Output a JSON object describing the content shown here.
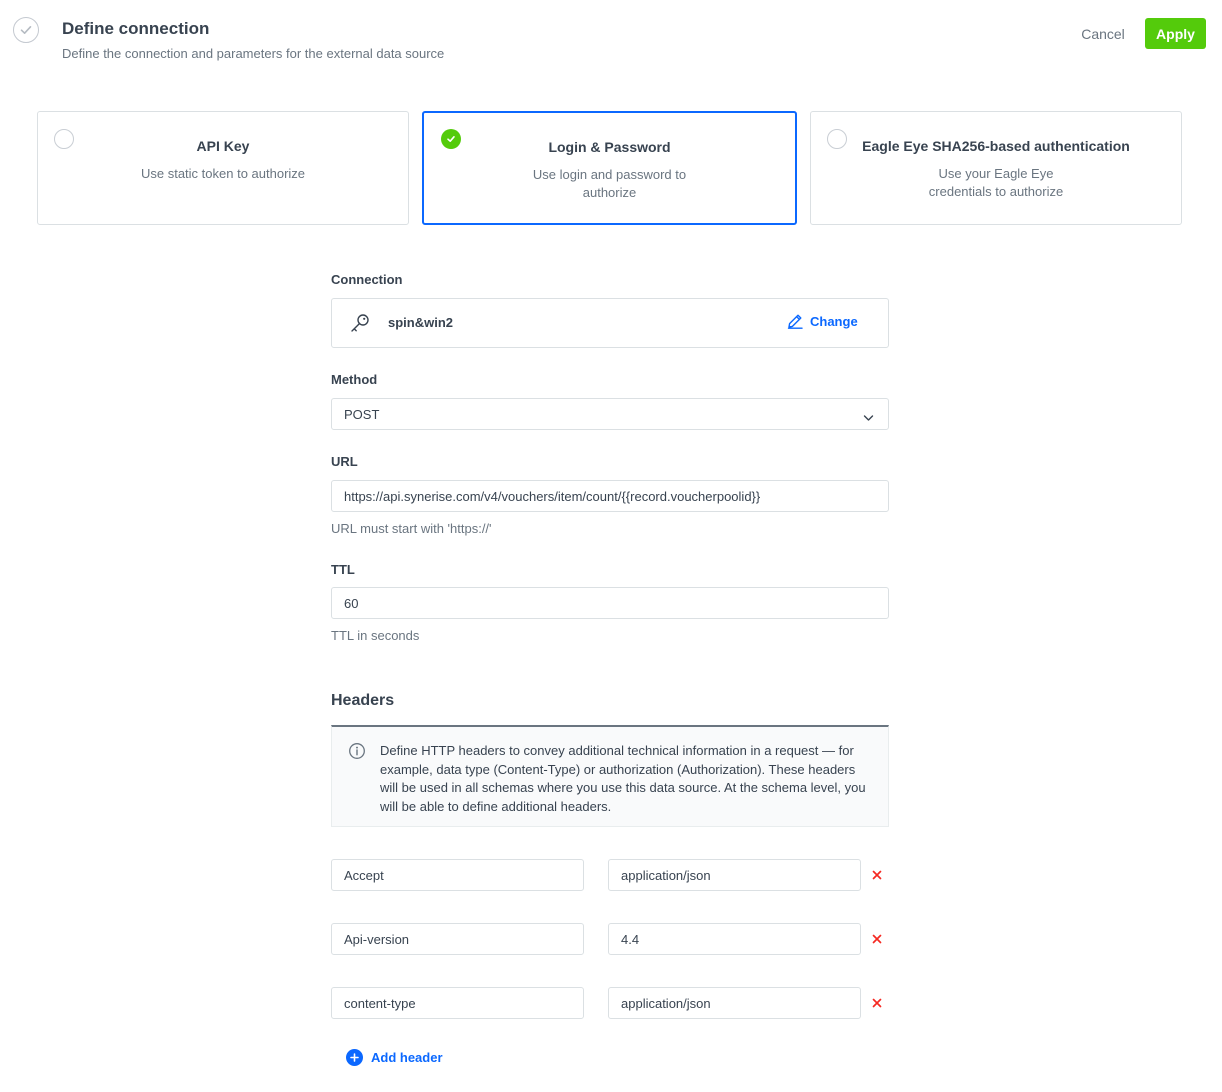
{
  "header": {
    "title": "Define connection",
    "subtitle": "Define the connection and parameters for the external data source",
    "cancel_label": "Cancel",
    "apply_label": "Apply"
  },
  "auth_options": [
    {
      "title": "API Key",
      "description": "Use static token to authorize",
      "selected": false
    },
    {
      "title": "Login & Password",
      "description": "Use login and password to authorize",
      "selected": true
    },
    {
      "title": "Eagle Eye SHA256-based authentication",
      "description": "Use your Eagle Eye credentials to authorize",
      "selected": false
    }
  ],
  "connection": {
    "label": "Connection",
    "name": "spin&win2",
    "change_label": "Change",
    "icon": "key-icon"
  },
  "method": {
    "label": "Method",
    "value": "POST"
  },
  "url": {
    "label": "URL",
    "value": "https://api.synerise.com/v4/vouchers/item/count/{{record.voucherpoolid}}",
    "hint": "URL must start with 'https://'"
  },
  "ttl": {
    "label": "TTL",
    "value": "60",
    "hint": "TTL in seconds"
  },
  "headers_section": {
    "title": "Headers",
    "info": "Define HTTP headers to convey additional technical information in a request — for example, data type (Content-Type) or authorization (Authorization). These headers will be used in all schemas where you use this data source. At the schema level, you will be able to define additional headers.",
    "rows": [
      {
        "key": "Accept",
        "value": "application/json"
      },
      {
        "key": "Api-version",
        "value": "4.4"
      },
      {
        "key": "content-type",
        "value": "application/json"
      }
    ],
    "add_label": "Add header"
  },
  "colors": {
    "primary": "#0b68ff",
    "success": "#54cb0b",
    "danger": "#f52922",
    "text": "#384350",
    "muted": "#6a7580",
    "border": "#dbe0e3"
  }
}
